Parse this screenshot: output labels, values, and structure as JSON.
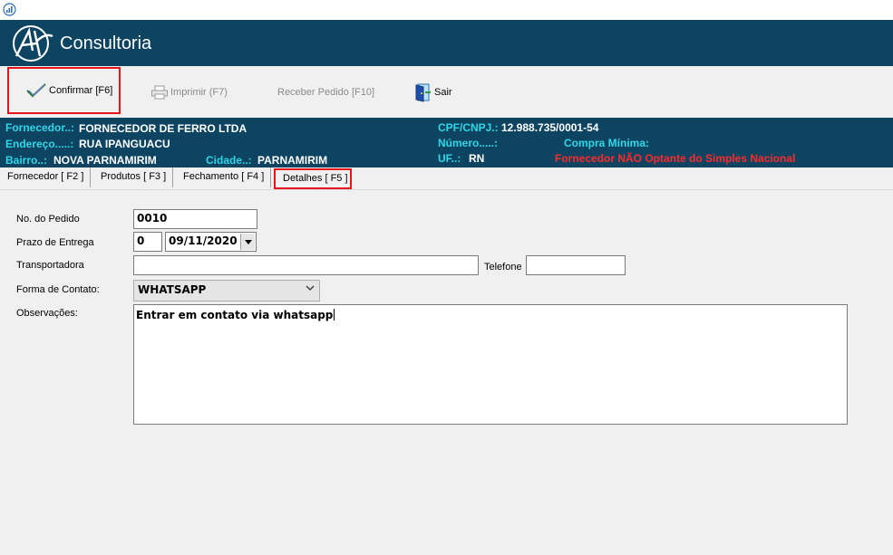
{
  "app": {
    "brand": "Consultoria"
  },
  "toolbar": {
    "confirmar": "Confirmar [F6]",
    "imprimir": "Imprimir  (F7)",
    "receber": "Receber Pedido [F10]",
    "sair": "Sair"
  },
  "supplier": {
    "fornecedor_label": "Fornecedor..:",
    "fornecedor_value": "FORNECEDOR DE FERRO LTDA",
    "endereco_label": "Endereço.....:",
    "endereco_value": "RUA IPANGUACU",
    "bairro_label": "Bairro..:",
    "bairro_value": "NOVA PARNAMIRIM",
    "cidade_label": "Cidade..:",
    "cidade_value": "PARNAMIRIM",
    "cpf_label": "CPF/CNPJ.:",
    "cpf_value": "12.988.735/0001-54",
    "numero_label": "Número.....:",
    "compra_label": "Compra Mínima:",
    "uf_label": "UF..:",
    "uf_value": "RN",
    "simples_warning": "Fornecedor NÃO Optante do Simples Nacional"
  },
  "tabs": [
    {
      "label": "Fornecedor [ F2 ]"
    },
    {
      "label": "Produtos [ F3 ]"
    },
    {
      "label": "Fechamento [ F4 ]"
    },
    {
      "label": "Detalhes [ F5 ]"
    }
  ],
  "form": {
    "pedido_label": "No. do Pedido",
    "pedido_value": "0010",
    "prazo_label": "Prazo de Entrega",
    "prazo_days": "0",
    "prazo_date": "09/11/2020",
    "transportadora_label": "Transportadora",
    "transportadora_value": "",
    "telefone_label": "Telefone",
    "telefone_value": "",
    "contato_label": "Forma de Contato:",
    "contato_value": "WHATSAPP",
    "obs_label": "Observações:",
    "obs_value": "Entrar em contato via whatsapp"
  },
  "colors": {
    "banner": "#0d4462",
    "label_cyan": "#2fd7e8",
    "warning_red": "#ff2a2a",
    "highlight_red": "#e8141b"
  }
}
